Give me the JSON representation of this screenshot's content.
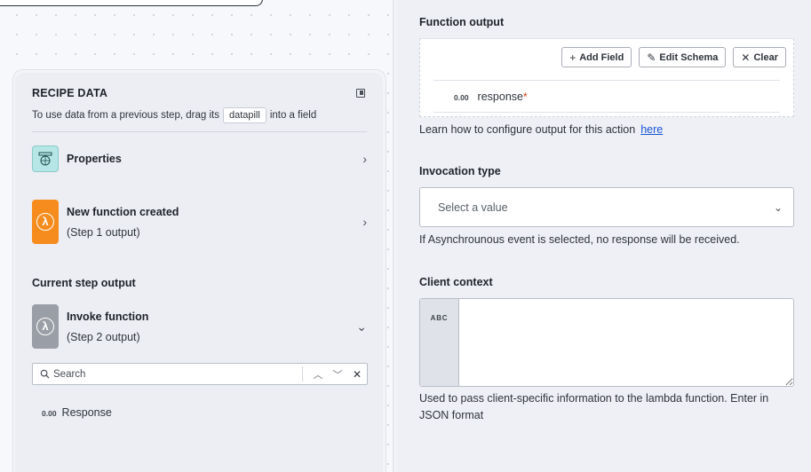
{
  "recipe": {
    "title": "RECIPE DATA",
    "hint_prefix": "To use data from a previous step, drag its",
    "hint_pill": "datapill",
    "hint_suffix": "into a field",
    "properties_label": "Properties",
    "step1_title": "New function created",
    "step1_sub": "(Step 1 output)",
    "current_step_label": "Current step output",
    "step2_title": "Invoke function",
    "step2_sub": "(Step 2 output)",
    "search_placeholder": "Search",
    "response_type": "0.00",
    "response_label": "Response"
  },
  "form": {
    "function_output_label": "Function output",
    "add_field": "Add Field",
    "edit_schema": "Edit Schema",
    "clear": "Clear",
    "output_field_type": "0.00",
    "output_field_name": "response",
    "output_field_required": "*",
    "output_help_text": "Learn how to configure output for this action",
    "output_help_link": "here",
    "invocation_label": "Invocation type",
    "invocation_placeholder": "Select a value",
    "invocation_help": "If Asynchrounous event is selected, no response will be received.",
    "client_context_label": "Client context",
    "client_context_type": "ABC",
    "client_context_help": "Used to pass client-specific information to the lambda function. Enter in JSON format"
  },
  "colors": {
    "lambda_orange": "#f78c1e",
    "lambda_gray": "#9a9ea6",
    "link": "#1a55d6",
    "required": "#d4380d"
  }
}
